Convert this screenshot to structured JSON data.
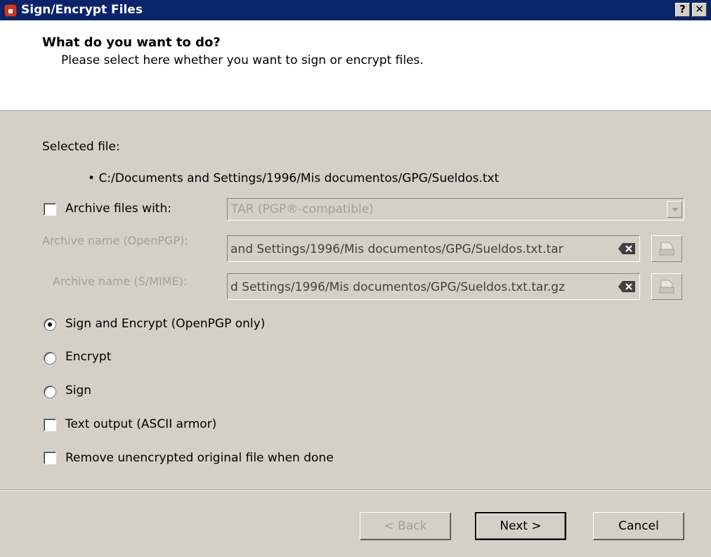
{
  "window": {
    "title": "Sign/Encrypt Files",
    "help_btn": "?",
    "close_btn": "✕"
  },
  "header": {
    "title": "What do you want to do?",
    "subtitle": "Please select here whether you want to sign or encrypt files."
  },
  "selected_file": {
    "label": "Selected file:",
    "bullet": "•",
    "path": "C:/Documents and Settings/1996/Mis documentos/GPG/Sueldos.txt"
  },
  "archive": {
    "checkbox_label": "Archive files with:",
    "checked": false,
    "format_value": "TAR (PGP®-compatible)",
    "openpgp_label": "Archive name (OpenPGP):",
    "openpgp_value": "and Settings/1996/Mis documentos/GPG/Sueldos.txt.tar",
    "smime_label": "Archive name (S/MIME):",
    "smime_value": "d Settings/1996/Mis documentos/GPG/Sueldos.txt.tar.gz"
  },
  "options": {
    "sign_and_encrypt": {
      "label": "Sign and Encrypt (OpenPGP only)",
      "selected": true
    },
    "encrypt": {
      "label": "Encrypt",
      "selected": false
    },
    "sign": {
      "label": "Sign",
      "selected": false
    },
    "text_output": {
      "label": "Text output (ASCII armor)",
      "checked": false
    },
    "remove_original": {
      "label": "Remove unencrypted original file when done",
      "checked": false
    }
  },
  "buttons": {
    "back": "< Back",
    "next": "Next >",
    "cancel": "Cancel"
  },
  "colors": {
    "titlebar": "#0a246a",
    "dialog_bg": "#d4d0c8",
    "header_bg": "#ffffff",
    "disabled_text": "#a0a0a0"
  },
  "icons": {
    "app": "kleopatra-app-icon",
    "clear": "clear-field-icon",
    "browse": "folder-open-icon"
  }
}
